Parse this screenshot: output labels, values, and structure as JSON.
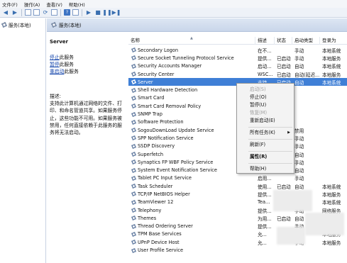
{
  "menubar": [
    "文件(F)",
    "操作(A)",
    "查看(V)",
    "帮助(H)"
  ],
  "toolbar": {
    "icons": [
      "back-arrow-icon",
      "forward-arrow-icon",
      "console-tree-icon",
      "list-view-icon",
      "refresh-icon",
      "export-icon",
      "help-icon",
      "properties-icon",
      "play-icon",
      "stop-icon",
      "pause-icon",
      "restart-icon"
    ]
  },
  "tree": {
    "item": "服务(本地)"
  },
  "header": {
    "title": "服务(本地)"
  },
  "details": {
    "service_name": "Server",
    "stop_link_action": "停止",
    "stop_link_suffix": "此服务",
    "pause_link_action": "暂停",
    "pause_link_suffix": "此服务",
    "restart_link_action": "重启动",
    "restart_link_suffix": "此服务",
    "desc_label": "描述:",
    "desc_text": "支持此计算机通过网络的文件、打印、和命名管道共享。如果服务停止，这些功能不可用。如果服务被禁用，任何直接依赖于此服务的服务将无法启动。"
  },
  "columns": {
    "name": "名称",
    "desc": "描述",
    "status": "状态",
    "startup": "启动类型",
    "login": "登录为"
  },
  "rows": [
    {
      "name": "Secondary Logon",
      "desc": "在不...",
      "status": "",
      "startup": "手动",
      "login": "本地系统"
    },
    {
      "name": "Secure Socket Tunneling Protocol Service",
      "desc": "提供...",
      "status": "已启动",
      "startup": "手动",
      "login": "本地服务"
    },
    {
      "name": "Security Accounts Manager",
      "desc": "启动...",
      "status": "已启动",
      "startup": "自动",
      "login": "本地系统"
    },
    {
      "name": "Security Center",
      "desc": "WSC...",
      "status": "已启动",
      "startup": "自动(延迟...",
      "login": "本地服务"
    },
    {
      "name": "Server",
      "desc": "支持...",
      "status": "已启动",
      "startup": "自动",
      "login": "本地系统"
    },
    {
      "name": "Shell Hardware Detection",
      "desc": "",
      "status": "",
      "startup": "",
      "login": ""
    },
    {
      "name": "Smart Card",
      "desc": "",
      "status": "",
      "startup": "",
      "login": ""
    },
    {
      "name": "Smart Card Removal Policy",
      "desc": "",
      "status": "",
      "startup": "",
      "login": ""
    },
    {
      "name": "SNMP Trap",
      "desc": "",
      "status": "",
      "startup": "",
      "login": ""
    },
    {
      "name": "Software Protection",
      "desc": "",
      "status": "",
      "startup": "",
      "login": ""
    },
    {
      "name": "SogouDownLoad Update Service",
      "desc": "",
      "status": "",
      "startup": "禁用",
      "login": ""
    },
    {
      "name": "SPP Notification Service",
      "desc": "",
      "status": "",
      "startup": "手动",
      "login": ""
    },
    {
      "name": "SSDP Discovery",
      "desc": "",
      "status": "",
      "startup": "手动",
      "login": ""
    },
    {
      "name": "Superfetch",
      "desc": "",
      "status": "",
      "startup": "自动",
      "login": ""
    },
    {
      "name": "Synaptics FP WBF Policy Service",
      "desc": "",
      "status": "",
      "startup": "手动",
      "login": ""
    },
    {
      "name": "System Event Notification Service",
      "desc": "",
      "status": "",
      "startup": "自动",
      "login": ""
    },
    {
      "name": "Tablet PC Input Service",
      "desc": "启用...",
      "status": "",
      "startup": "手动",
      "login": ""
    },
    {
      "name": "Task Scheduler",
      "desc": "使用...",
      "status": "已启动",
      "startup": "自动",
      "login": "本地系统"
    },
    {
      "name": "TCP/IP NetBIOS Helper",
      "desc": "提供...",
      "status": "已启动",
      "startup": "自动",
      "login": "本地服务"
    },
    {
      "name": "TeamViewer 12",
      "desc": "Tea...",
      "status": "",
      "startup": "禁用",
      "login": "本地系统"
    },
    {
      "name": "Telephony",
      "desc": "提供...",
      "status": "",
      "startup": "手动",
      "login": "网络服务"
    },
    {
      "name": "Themes",
      "desc": "为用...",
      "status": "已启动",
      "startup": "自动",
      "login": "本地系统"
    },
    {
      "name": "Thread Ordering Server",
      "desc": "提供...",
      "status": "",
      "startup": "手动",
      "login": "本地服务"
    },
    {
      "name": "TPM Base Services",
      "desc": "允...",
      "status": "",
      "startup": "手动",
      "login": "本地服务"
    },
    {
      "name": "UPnP Device Host",
      "desc": "允...",
      "status": "",
      "startup": "手动",
      "login": "本地服务"
    },
    {
      "name": "User Profile Service",
      "desc": "",
      "status": "",
      "startup": "",
      "login": ""
    }
  ],
  "selected_index": 4,
  "context_menu": {
    "start": "启动(S)",
    "stop": "停止(O)",
    "pause": "暂停(U)",
    "resume": "恢复(M)",
    "restart": "重新启动(E)",
    "all_tasks": "所有任务(K)",
    "refresh": "刷新(F)",
    "properties": "属性(R)",
    "help": "帮助(H)"
  },
  "colors": {
    "selection": "#3f7fd6",
    "link": "#0b3ea8",
    "header_bg": "#dde6f3"
  }
}
